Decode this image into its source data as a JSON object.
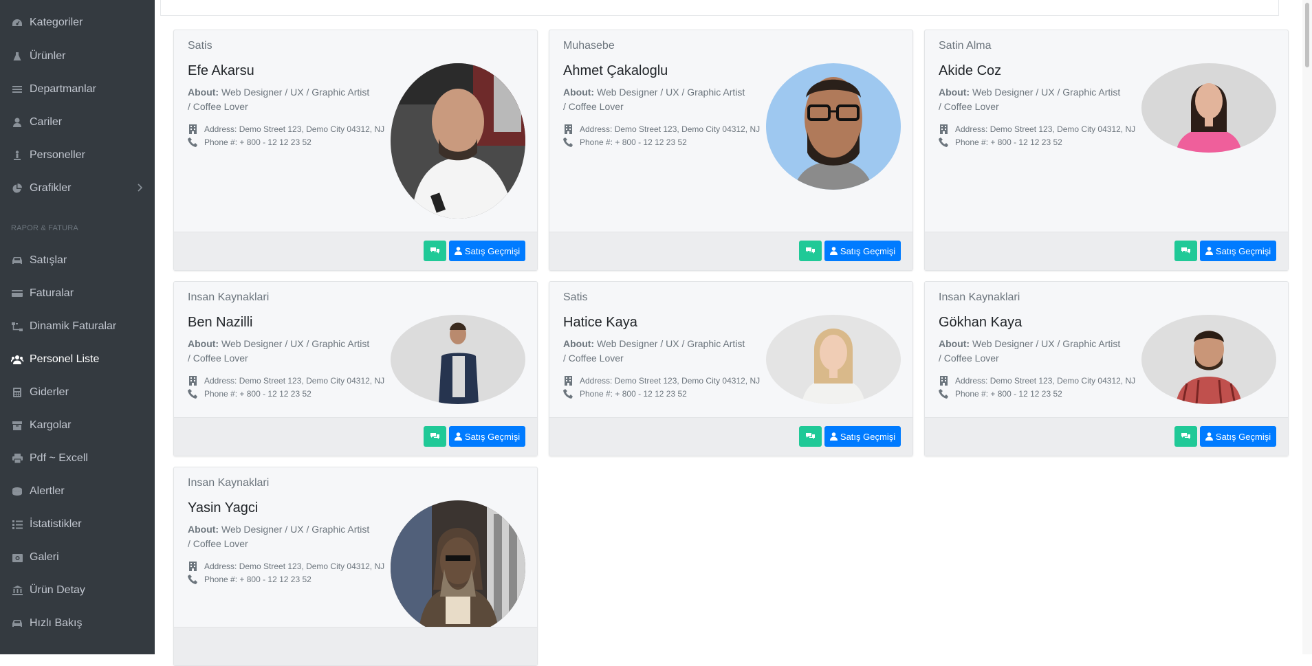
{
  "sidebar": {
    "items": [
      {
        "label": "Kategoriler",
        "icon": "dashboard-icon"
      },
      {
        "label": "Ürünler",
        "icon": "flask-icon"
      },
      {
        "label": "Departmanlar",
        "icon": "list-icon"
      },
      {
        "label": "Cariler",
        "icon": "user-icon"
      },
      {
        "label": "Personeller",
        "icon": "person-icon"
      },
      {
        "label": "Grafikler",
        "icon": "pie-chart-icon"
      }
    ],
    "section_header": "RAPOR & FATURA",
    "items2": [
      {
        "label": "Satışlar",
        "icon": "car-icon"
      },
      {
        "label": "Faturalar",
        "icon": "credit-card-icon"
      },
      {
        "label": "Dinamik Faturalar",
        "icon": "sitemap-icon"
      },
      {
        "label": "Personel Liste",
        "icon": "users-icon",
        "active": true
      },
      {
        "label": "Giderler",
        "icon": "calculator-icon"
      },
      {
        "label": "Kargolar",
        "icon": "box-icon"
      },
      {
        "label": "Pdf ~ Excell",
        "icon": "print-icon"
      },
      {
        "label": "Alertler",
        "icon": "database-icon"
      },
      {
        "label": "İstatistikler",
        "icon": "tasks-icon"
      },
      {
        "label": "Galeri",
        "icon": "gallery-icon"
      },
      {
        "label": "Ürün Detay",
        "icon": "bank-icon"
      },
      {
        "label": "Hızlı Bakış",
        "icon": "car-icon"
      }
    ]
  },
  "cards": [
    {
      "dept": "Satis",
      "name": "Efe Akarsu",
      "about_label": "About:",
      "about": "Web Designer / UX / Graphic Artist / Coffee Lover",
      "address": "Address: Demo Street 123, Demo City 04312, NJ",
      "phone": "Phone #: + 800 - 12 12 23 52",
      "button": "Satış Geçmişi"
    },
    {
      "dept": "Muhasebe",
      "name": "Ahmet Çakaloglu",
      "about_label": "About:",
      "about": "Web Designer / UX / Graphic Artist / Coffee Lover",
      "address": "Address: Demo Street 123, Demo City 04312, NJ",
      "phone": "Phone #: + 800 - 12 12 23 52",
      "button": "Satış Geçmişi"
    },
    {
      "dept": "Satin Alma",
      "name": "Akide Coz",
      "about_label": "About:",
      "about": "Web Designer / UX / Graphic Artist / Coffee Lover",
      "address": "Address: Demo Street 123, Demo City 04312, NJ",
      "phone": "Phone #: + 800 - 12 12 23 52",
      "button": "Satış Geçmişi"
    },
    {
      "dept": "Insan Kaynaklari",
      "name": "Ben Nazilli",
      "about_label": "About:",
      "about": "Web Designer / UX / Graphic Artist / Coffee Lover",
      "address": "Address: Demo Street 123, Demo City 04312, NJ",
      "phone": "Phone #: + 800 - 12 12 23 52",
      "button": "Satış Geçmişi"
    },
    {
      "dept": "Satis",
      "name": "Hatice Kaya",
      "about_label": "About:",
      "about": "Web Designer / UX / Graphic Artist / Coffee Lover",
      "address": "Address: Demo Street 123, Demo City 04312, NJ",
      "phone": "Phone #: + 800 - 12 12 23 52",
      "button": "Satış Geçmişi"
    },
    {
      "dept": "Insan Kaynaklari",
      "name": "Gökhan Kaya",
      "about_label": "About:",
      "about": "Web Designer / UX / Graphic Artist / Coffee Lover",
      "address": "Address: Demo Street 123, Demo City 04312, NJ",
      "phone": "Phone #: + 800 - 12 12 23 52",
      "button": "Satış Geçmişi"
    },
    {
      "dept": "Insan Kaynaklari",
      "name": "Yasin Yagci",
      "about_label": "About:",
      "about": "Web Designer / UX / Graphic Artist / Coffee Lover",
      "address": "Address: Demo Street 123, Demo City 04312, NJ",
      "phone": "Phone #: + 800 - 12 12 23 52",
      "button": "Satış Geçmişi"
    }
  ],
  "colors": {
    "sidebar_bg": "#343a40",
    "chat_button": "#20c997",
    "history_button": "#007bff"
  }
}
